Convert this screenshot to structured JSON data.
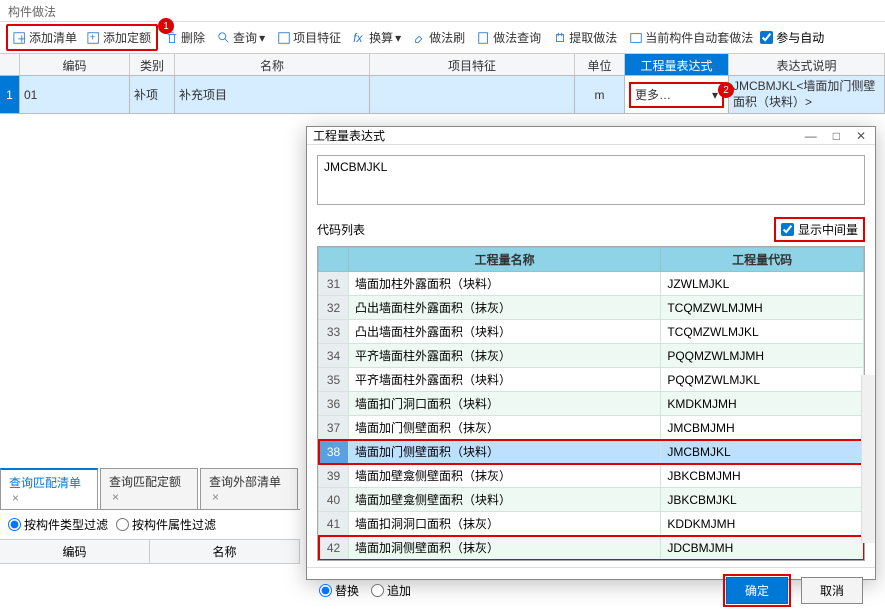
{
  "window": {
    "title": "构件做法"
  },
  "toolbar": {
    "add_list": "添加清单",
    "add_quota": "添加定额",
    "delete": "删除",
    "query": "查询",
    "item_feature": "项目特征",
    "convert": "换算",
    "brush": "做法刷",
    "method_query": "做法查询",
    "extract": "提取做法",
    "current_auto": "当前构件自动套做法",
    "auto_checkbox": "参与自动"
  },
  "grid": {
    "headers": {
      "code": "编码",
      "cat": "类别",
      "name": "名称",
      "feat": "项目特征",
      "unit": "单位",
      "exp": "工程量表达式",
      "desc": "表达式说明"
    },
    "row": {
      "idx": "1",
      "code": "01",
      "cat": "补项",
      "name": "补充项目",
      "feat": "",
      "unit": "m",
      "exp_more": "更多…",
      "desc": "JMCBMJKL<墙面加门侧壁面积（块料）>"
    }
  },
  "tabs": {
    "t1": "查询匹配清单",
    "t2": "查询匹配定额",
    "t3": "查询外部清单"
  },
  "filter": {
    "by_type": "按构件类型过滤",
    "by_attr": "按构件属性过滤",
    "col_code": "编码",
    "col_name": "名称"
  },
  "dialog": {
    "title": "工程量表达式",
    "expr": "JMCBMJKL",
    "codelist_label": "代码列表",
    "show_mid": "显示中间量",
    "col_name": "工程量名称",
    "col_code": "工程量代码",
    "replace": "替换",
    "append": "追加",
    "ok": "确定",
    "cancel": "取消",
    "rows": [
      {
        "n": "31",
        "name": "墙面加柱外露面积（块料）",
        "code": "JZWLMJKL"
      },
      {
        "n": "32",
        "name": "凸出墙面柱外露面积（抹灰）",
        "code": "TCQMZWLMJMH"
      },
      {
        "n": "33",
        "name": "凸出墙面柱外露面积（块料）",
        "code": "TCQMZWLMJKL"
      },
      {
        "n": "34",
        "name": "平齐墙面柱外露面积（抹灰）",
        "code": "PQQMZWLMJMH"
      },
      {
        "n": "35",
        "name": "平齐墙面柱外露面积（块料）",
        "code": "PQQMZWLMJKL"
      },
      {
        "n": "36",
        "name": "墙面扣门洞口面积（块料）",
        "code": "KMDKMJMH"
      },
      {
        "n": "37",
        "name": "墙面加门侧壁面积（抹灰）",
        "code": "JMCBMJMH"
      },
      {
        "n": "38",
        "name": "墙面加门侧壁面积（块料）",
        "code": "JMCBMJKL"
      },
      {
        "n": "39",
        "name": "墙面加壁龛侧壁面积（抹灰）",
        "code": "JBKCBMJMH"
      },
      {
        "n": "40",
        "name": "墙面加壁龛侧壁面积（块料）",
        "code": "JBKCBMJKL"
      },
      {
        "n": "41",
        "name": "墙面扣洞洞口面积（抹灰）",
        "code": "KDDKMJMH"
      },
      {
        "n": "42",
        "name": "墙面加洞侧壁面积（抹灰）",
        "code": "JDCBMJMH"
      }
    ]
  }
}
